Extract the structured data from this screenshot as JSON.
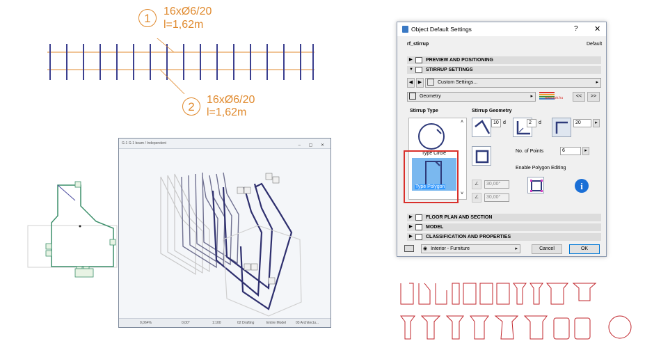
{
  "callouts": [
    {
      "number": "1",
      "line1": "16xØ6/20",
      "line2": "l=1,62m"
    },
    {
      "number": "2",
      "line1": "16xØ6/20",
      "line2": "l=1,62m"
    }
  ],
  "viewer": {
    "title": "G-1 G-1 beam / Independent",
    "status": {
      "zoom": "0,064%",
      "angle": "0,00°",
      "scale": "1:100",
      "layer": "02 Drafting",
      "model": "Entire Model",
      "structure": "03 Architectu..."
    }
  },
  "dialog": {
    "title": "Object Default Settings",
    "help_label": "?",
    "close_label": "✕",
    "object_name": "rf_stirrup",
    "default_label": "Default",
    "sections": {
      "preview": "PREVIEW AND POSITIONING",
      "stirrup": "STIRRUP SETTINGS",
      "floor": "FLOOR PLAN AND SECTION",
      "model": "MODEL",
      "classification": "CLASSIFICATION AND PROPERTIES"
    },
    "custom_settings": "Custom Settings...",
    "geometry": "Geometry",
    "brand_text": "www.rptr.hu",
    "nav_prev": "<<",
    "nav_next": ">>",
    "stirrup_type_label": "Stirrup Type",
    "stirrup_geometry_label": "Stirrup Geometry",
    "type_circle": "Type Circle",
    "type_polygon": "Type Polygon",
    "hook_value": "10",
    "hook_unit": "d",
    "bend_value": "2",
    "bend_unit": "d",
    "length_value": "20",
    "num_points_label": "No. of Points",
    "num_points_value": "6",
    "enable_polygon_label": "Enable Polygon Editing",
    "angle1": "30,00°",
    "angle2": "30,00°",
    "layer_value": "Interior - Furniture",
    "cancel_label": "Cancel",
    "ok_label": "OK"
  },
  "colors": {
    "callout": "#e08a2e",
    "rebar_outline": "#c0242b",
    "stirrup_plan": "#3b3f8f",
    "selection_red": "#d9302b",
    "selection_blue": "#3399ff"
  },
  "icons": [
    "circle-stirrup-icon",
    "polygon-stirrup-icon",
    "hook-angle-icon",
    "bend-icon",
    "corner-icon",
    "square-icon",
    "info-icon",
    "polygon-edit-icon"
  ]
}
